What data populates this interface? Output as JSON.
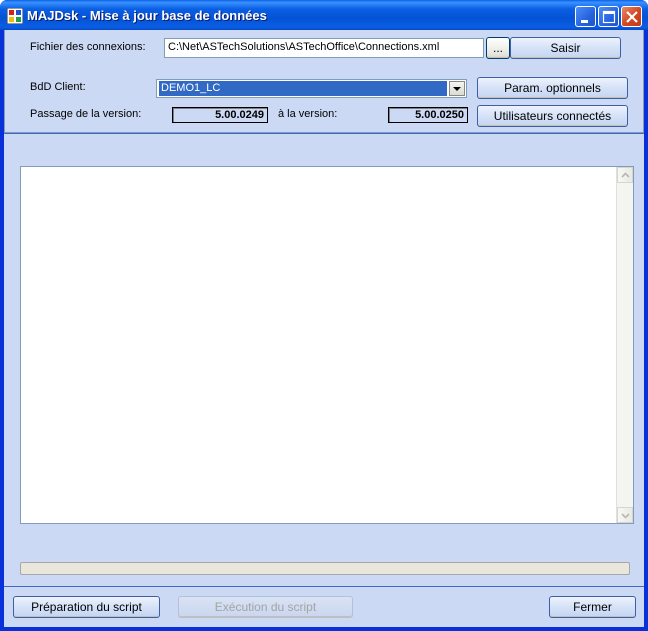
{
  "window": {
    "title": "MAJDsk - Mise à jour base de données"
  },
  "connection": {
    "file_label": "Fichier des connexions:",
    "file_value": "C:\\Net\\ASTechSolutions\\ASTechOffice\\Connections.xml",
    "browse_label": "...",
    "saisir_label": "Saisir"
  },
  "client": {
    "label": "BdD Client:",
    "selected": "DEMO1_LC",
    "params_label": "Param. optionnels"
  },
  "version": {
    "from_label": "Passage de la version:",
    "from_value": "5.00.0249",
    "to_label": "à la version:",
    "to_value": "5.00.0250",
    "users_label": "Utilisateurs connectés"
  },
  "footer": {
    "prepare_label": "Préparation du script",
    "execute_label": "Exécution du script",
    "close_label": "Fermer"
  },
  "progress": {
    "value": 0
  }
}
